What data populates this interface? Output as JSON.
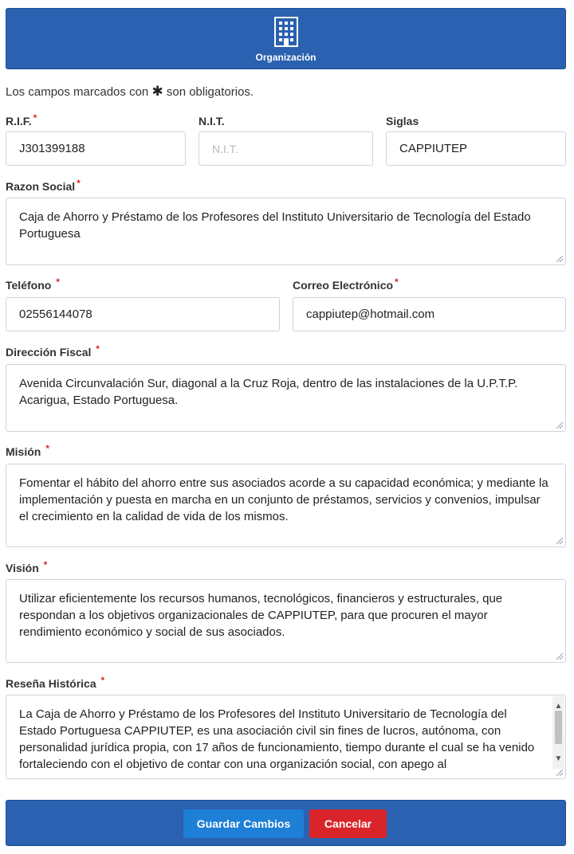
{
  "header": {
    "title": "Organización",
    "icon": "building-icon"
  },
  "notice": {
    "before": "Los campos marcados con",
    "star": "✱",
    "after": "son obligatorios."
  },
  "fields": {
    "rif": {
      "label": "R.I.F.",
      "value": "J301399188",
      "required": "*"
    },
    "nit": {
      "label": "N.I.T.",
      "placeholder": "N.I.T."
    },
    "siglas": {
      "label": "Siglas",
      "value": "CAPPIUTEP"
    },
    "razon_social": {
      "label": "Razon Social",
      "required": "*",
      "value": "Caja de Ahorro y Préstamo de los Profesores del Instituto Universitario de Tecnología del Estado Portuguesa"
    },
    "telefono": {
      "label": "Teléfono",
      "required": "*",
      "value": "02556144078"
    },
    "correo": {
      "label": "Correo Electrónico",
      "required": "*",
      "value": "cappiutep@hotmail.com"
    },
    "direccion": {
      "label": "Dirección Fiscal",
      "required": "*",
      "value": "Avenida Circunvalación Sur, diagonal a la Cruz Roja, dentro de las instalaciones de la U.P.T.P. Acarigua, Estado Portuguesa."
    },
    "mision": {
      "label": "Misión",
      "required": "*",
      "value": "Fomentar el hábito del ahorro entre sus asociados acorde a su capacidad económica; y mediante la implementación y puesta en marcha en un conjunto de préstamos, servicios y convenios, impulsar el crecimiento en la calidad de vida de los mismos."
    },
    "vision": {
      "label": "Visión",
      "required": "*",
      "value": "Utilizar eficientemente los recursos humanos, tecnológicos, financieros y estructurales, que respondan a los objetivos organizacionales de CAPPIUTEP, para que procuren el mayor rendimiento económico y social de sus asociados."
    },
    "resena": {
      "label": "Reseña Histórica",
      "required": "*",
      "value": "La Caja de Ahorro y Préstamo de los Profesores del Instituto Universitario de Tecnología del Estado Portuguesa CAPPIUTEP, es una asociación civil sin fines de lucros, autónoma, con personalidad jurídica propia, con 17 años de funcionamiento, tiempo durante el cual se ha venido fortaleciendo con el objetivo de contar con una organización social, con apego al"
    }
  },
  "buttons": {
    "save": "Guardar Cambios",
    "cancel": "Cancelar"
  },
  "colors": {
    "header": "#2a61b0",
    "save": "#1e7fd6",
    "cancel": "#d9252a",
    "required": "#d62a2a"
  }
}
